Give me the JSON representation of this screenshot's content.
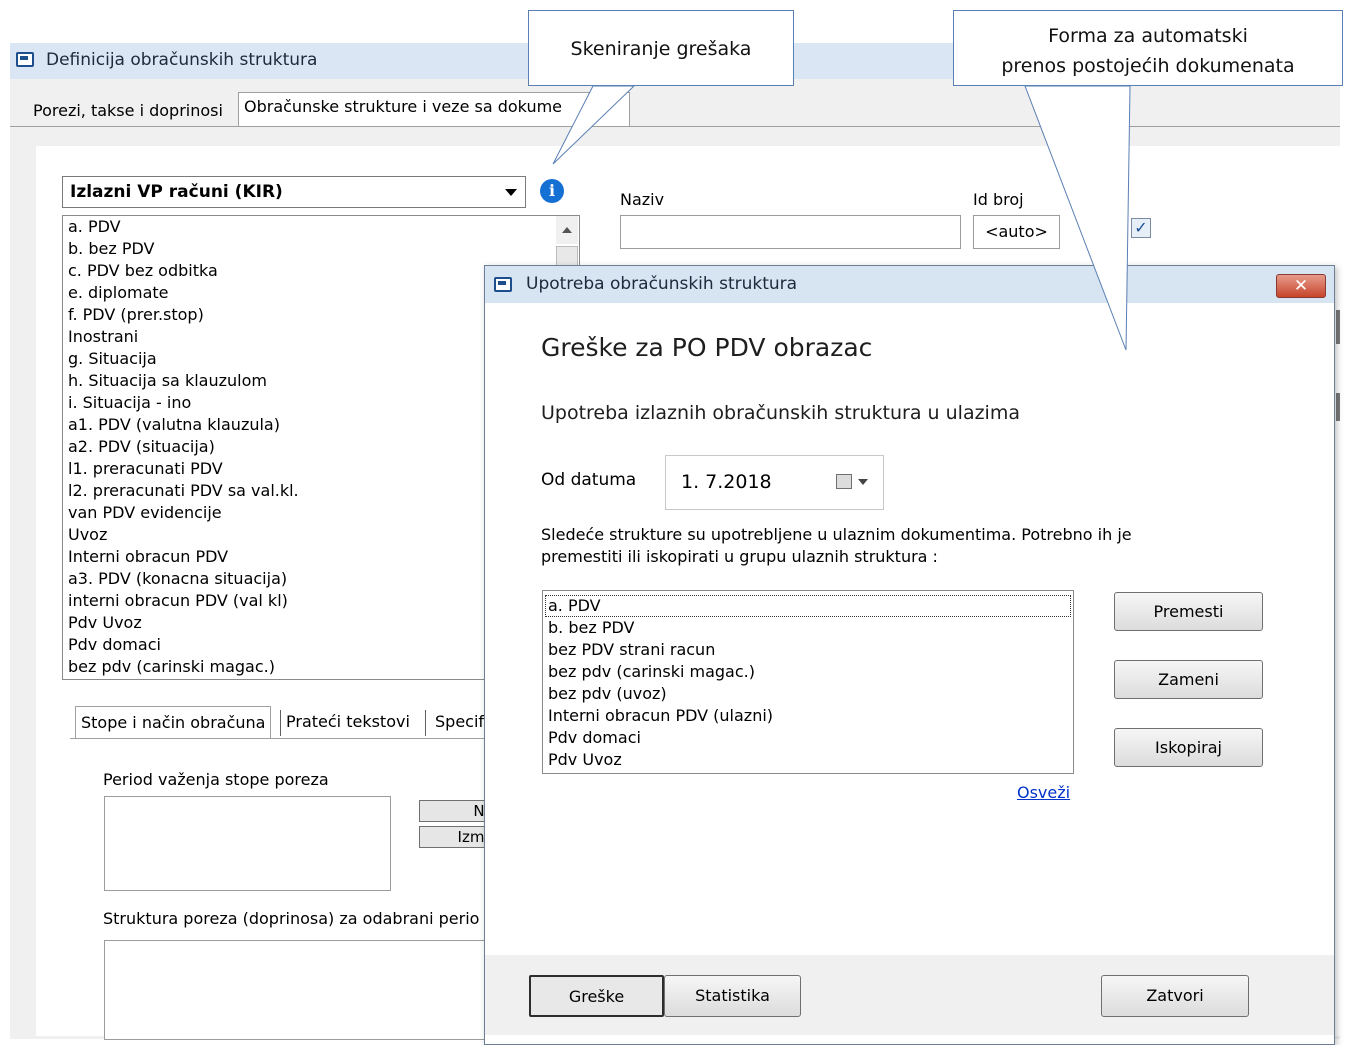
{
  "main_window": {
    "title": "Definicija obračunskih struktura",
    "tabs": [
      "Porezi, takse i doprinosi",
      "Obračunske strukture i veze sa dokume"
    ],
    "structure_combo": "Izlazni VP računi (KIR)",
    "structures": [
      "a. PDV",
      "b. bez PDV",
      "c. PDV bez odbitka",
      "e. diplomate",
      "f. PDV (prer.stop)",
      "Inostrani",
      "g. Situacija",
      "h. Situacija sa klauzulom",
      "i. Situacija - ino",
      "a1. PDV (valutna klauzula)",
      "a2. PDV (situacija)",
      "l1. preracunati PDV",
      "l2. preracunati PDV sa val.kl.",
      "van PDV evidencije",
      "Uvoz",
      "Interni obracun PDV",
      "a3. PDV (konacna situacija)",
      "interni obracun PDV (val kl)",
      "Pdv Uvoz",
      "Pdv domaci",
      "bez pdv (carinski magac.)"
    ],
    "naziv_label": "Naziv",
    "naziv_value": "",
    "id_label": "Id broj",
    "id_value": "<auto>",
    "checkbox_checked": true,
    "subtabs": [
      "Stope i način obračuna",
      "Prateći tekstovi",
      "Specif"
    ],
    "period_label": "Period važenja stope poreza",
    "btn_new": "N",
    "btn_edit": "Izm",
    "structure_label": "Struktura poreza (doprinosa) za odabrani perio"
  },
  "dialog": {
    "title": "Upotreba obračunskih struktura",
    "heading": "Greške za PO PDV obrazac",
    "subheading": "Upotreba izlaznih obračunskih struktura u ulazima",
    "date_label": "Od datuma",
    "date_value": "1.  7.2018",
    "description": "Sledeće strukture su upotrebljene u ulaznim dokumentima. Potrebno ih je premestiti ili iskopirati u grupu ulaznih struktura :",
    "items": [
      "a. PDV",
      "b. bez PDV",
      "bez  PDV strani racun",
      "bez pdv (carinski magac.)",
      "bez pdv (uvoz)",
      "Interni obracun PDV (ulazni)",
      "Pdv domaci",
      "Pdv Uvoz"
    ],
    "btn_move": "Premesti",
    "btn_replace": "Zameni",
    "btn_copy": "Iskopiraj",
    "refresh_link": "Osveži",
    "btn_errors": "Greške",
    "btn_stats": "Statistika",
    "btn_close": "Zatvori",
    "close_icon": "close-x-icon"
  },
  "callouts": {
    "scan_errors": "Skeniranje grešaka",
    "auto_transfer_line1": "Forma za automatski",
    "auto_transfer_line2": "prenos postojećih dokumenata"
  },
  "colors": {
    "titlebar": "#dbe6f4",
    "info_icon": "#1570d4",
    "close_button": "#c7452c",
    "link": "#0033cc",
    "callout_border": "#5a7fb3"
  }
}
